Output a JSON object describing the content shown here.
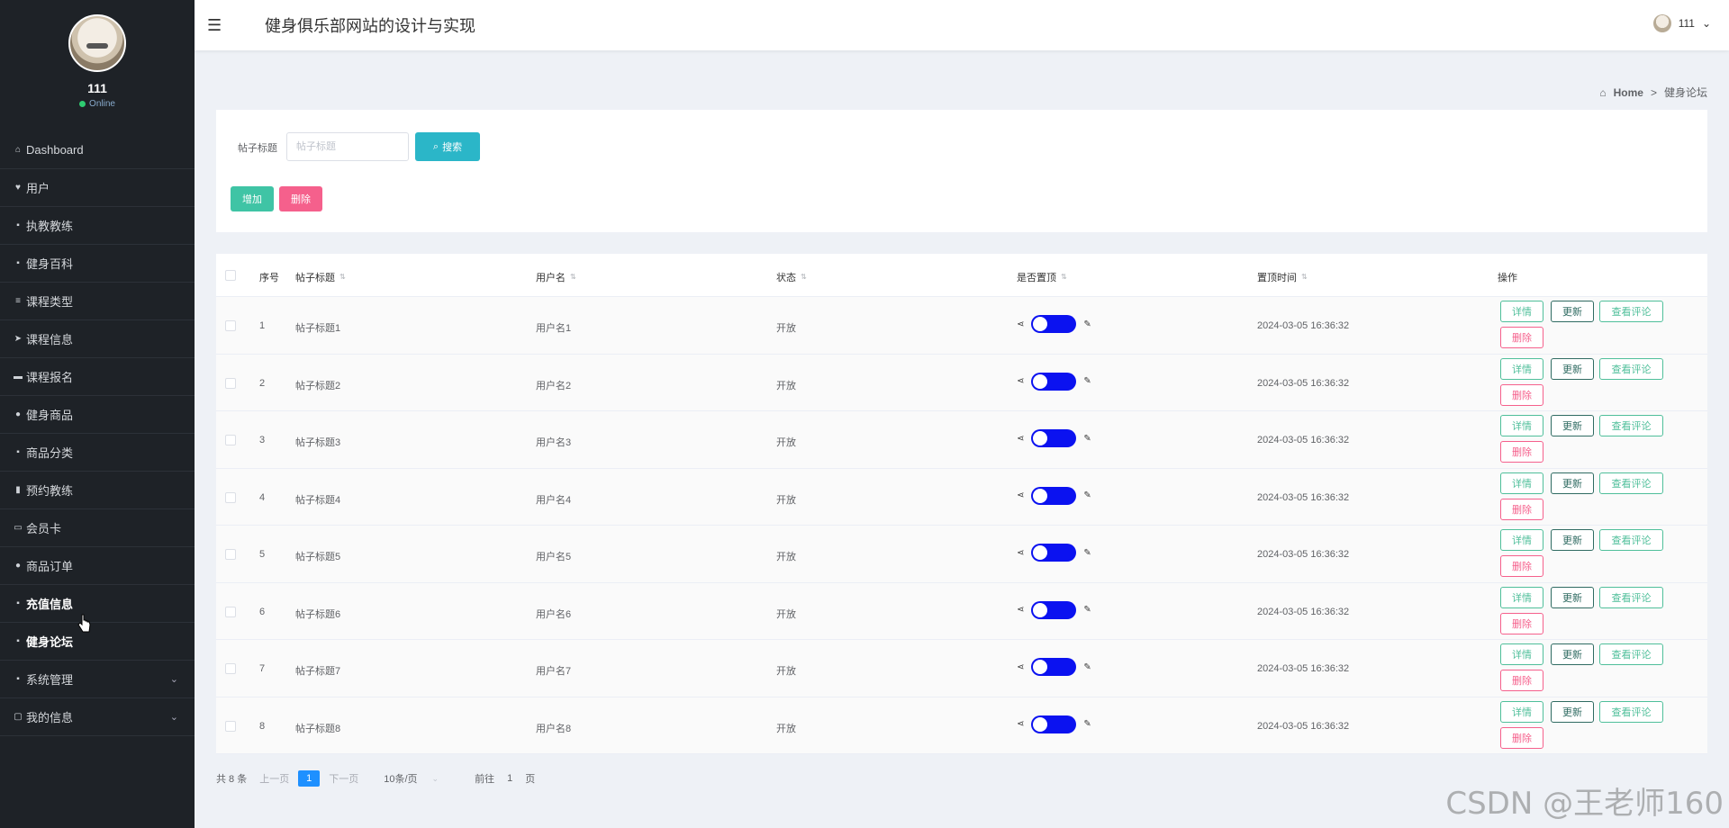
{
  "sidebar": {
    "profile": {
      "name": "111",
      "status": "Online"
    },
    "items": [
      {
        "label": "Dashboard",
        "icon": "home-icon"
      },
      {
        "label": "用户",
        "icon": "user-icon"
      },
      {
        "label": "执教教练",
        "icon": "grid-icon"
      },
      {
        "label": "健身百科",
        "icon": "grid-icon"
      },
      {
        "label": "课程类型",
        "icon": "list-icon"
      },
      {
        "label": "课程信息",
        "icon": "send-icon"
      },
      {
        "label": "课程报名",
        "icon": "inbox-icon"
      },
      {
        "label": "健身商品",
        "icon": "person-icon"
      },
      {
        "label": "商品分类",
        "icon": "grid-icon"
      },
      {
        "label": "预约教练",
        "icon": "chart-icon"
      },
      {
        "label": "会员卡",
        "icon": "card-icon"
      },
      {
        "label": "商品订单",
        "icon": "pin-icon"
      },
      {
        "label": "充值信息",
        "icon": "grid-icon"
      },
      {
        "label": "健身论坛",
        "icon": "grid-icon"
      },
      {
        "label": "系统管理",
        "icon": "grid-icon"
      },
      {
        "label": "我的信息",
        "icon": "window-icon"
      }
    ]
  },
  "header": {
    "title": "健身俱乐部网站的设计与实现",
    "user": "111"
  },
  "breadcrumb": {
    "home": "Home",
    "separator": ">",
    "current": "健身论坛"
  },
  "search": {
    "label": "帖子标题",
    "placeholder": "帖子标题",
    "button": "搜索"
  },
  "actions": {
    "add": "增加",
    "delete": "删除"
  },
  "table": {
    "headers": {
      "index": "序号",
      "title": "帖子标题",
      "username": "用户名",
      "status": "状态",
      "pinned": "是否置顶",
      "pin_time": "置顶时间",
      "ops": "操作"
    },
    "op_labels": {
      "detail": "详情",
      "update": "更新",
      "comments": "查看评论",
      "delete": "删除"
    },
    "rows": [
      {
        "index": "1",
        "title": "帖子标题1",
        "username": "用户名1",
        "status": "开放",
        "pin_time": "2024-03-05 16:36:32"
      },
      {
        "index": "2",
        "title": "帖子标题2",
        "username": "用户名2",
        "status": "开放",
        "pin_time": "2024-03-05 16:36:32"
      },
      {
        "index": "3",
        "title": "帖子标题3",
        "username": "用户名3",
        "status": "开放",
        "pin_time": "2024-03-05 16:36:32"
      },
      {
        "index": "4",
        "title": "帖子标题4",
        "username": "用户名4",
        "status": "开放",
        "pin_time": "2024-03-05 16:36:32"
      },
      {
        "index": "5",
        "title": "帖子标题5",
        "username": "用户名5",
        "status": "开放",
        "pin_time": "2024-03-05 16:36:32"
      },
      {
        "index": "6",
        "title": "帖子标题6",
        "username": "用户名6",
        "status": "开放",
        "pin_time": "2024-03-05 16:36:32"
      },
      {
        "index": "7",
        "title": "帖子标题7",
        "username": "用户名7",
        "status": "开放",
        "pin_time": "2024-03-05 16:36:32"
      },
      {
        "index": "8",
        "title": "帖子标题8",
        "username": "用户名8",
        "status": "开放",
        "pin_time": "2024-03-05 16:36:32"
      }
    ]
  },
  "pagination": {
    "total": "共 8 条",
    "prev": "上一页",
    "current": "1",
    "next": "下一页",
    "page_size": "10条/页",
    "goto_prefix": "前往",
    "goto_value": "1",
    "goto_suffix": "页"
  },
  "watermark": "CSDN @王老师160",
  "colors": {
    "sidebar_bg": "#1e2227",
    "search_btn": "#2bb6c8",
    "add_btn": "#3fc4a5",
    "delete_btn": "#f5608c",
    "toggle_on": "#0b12f0",
    "page_active": "#1e90ff"
  }
}
